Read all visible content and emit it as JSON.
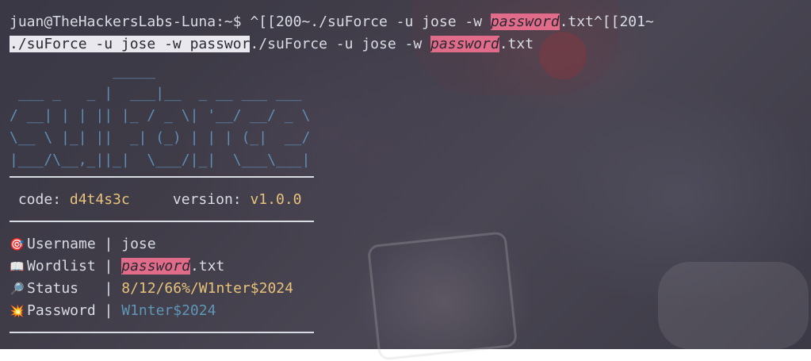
{
  "terminal": {
    "prompt": "juan@TheHackersLabs-Luna:~$",
    "cmd_line1_a": " ^[[200~./suForce -u jose -w ",
    "cmd_line1_hl": "password",
    "cmd_line1_b": ".txt^[[201~",
    "cmd_line2_sel": "./suForce -u jose -w passwor",
    "cmd_line2_a": "./suForce -u jose -w ",
    "cmd_line2_hl": "password",
    "cmd_line2_b": ".txt"
  },
  "banner": {
    "ascii": "            _____\n ___ _   _ |  ___|__  _ __ ___ ___\n/ __| | | || |_ / _ \\| '__/ __/ _ \\\n\\__ \\ |_| ||  _| (_) | | | (_|  __/\n|___/\\__,_||_|  \\___/|_|  \\___\\___|",
    "code_label": "code:",
    "code_value": "d4t4s3c",
    "version_label": "version:",
    "version_value": "v1.0.0"
  },
  "results": {
    "username_icon": "target-icon",
    "username_label": "Username",
    "username_value": "jose",
    "wordlist_icon": "book-icon",
    "wordlist_label": "Wordlist",
    "wordlist_value_hl": "password",
    "wordlist_value_rest": ".txt",
    "status_icon": "magnifier-icon",
    "status_label": "Status",
    "status_value": "8/12/66%/W1nter$2024",
    "password_icon": "collision-icon",
    "password_label": "Password",
    "password_value": "W1nter$2024",
    "separator": "|"
  },
  "colors": {
    "highlight": "#e06c8a",
    "ascii": "#5f8db5",
    "yellow": "#e8c27a",
    "blue": "#5f96b8"
  }
}
